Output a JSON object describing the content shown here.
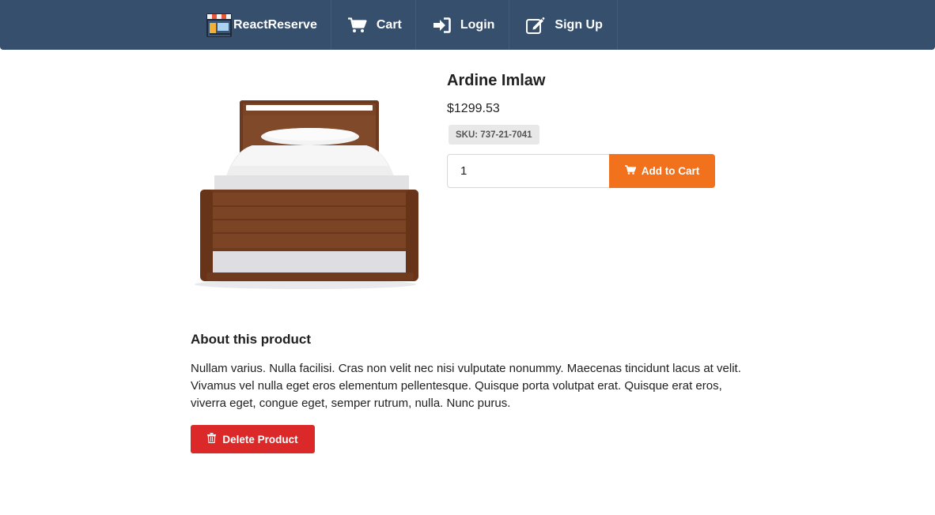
{
  "nav": {
    "brand": {
      "label": "ReactReserve",
      "icon": "storefront-logo-icon"
    },
    "items": [
      {
        "label": "Cart",
        "icon": "shopping-cart-icon"
      },
      {
        "label": "Login",
        "icon": "sign-in-icon"
      },
      {
        "label": "Sign Up",
        "icon": "edit-icon"
      }
    ]
  },
  "product": {
    "name": "Ardine Imlaw",
    "price": "$1299.53",
    "sku": "SKU: 737-21-7041",
    "image": "wooden-bed-image",
    "quantity": "1",
    "add_to_cart_label": "Add to Cart"
  },
  "about": {
    "heading": "About this product",
    "description": "Nullam varius. Nulla facilisi. Cras non velit nec nisi vulputate nonummy. Maecenas tincidunt lacus at velit. Vivamus vel nulla eget eros elementum pellentesque. Quisque porta volutpat erat. Quisque erat eros, viverra eget, congue eget, semper rutrum, nulla. Nunc purus."
  },
  "actions": {
    "delete_label": "Delete Product"
  },
  "colors": {
    "navbar": "#354f6d",
    "add_to_cart": "#f2711c",
    "delete": "#db2828"
  }
}
